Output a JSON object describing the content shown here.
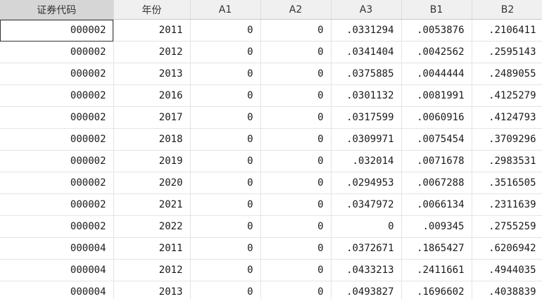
{
  "columns": [
    "证券代码",
    "年份",
    "A1",
    "A2",
    "A3",
    "B1",
    "B2"
  ],
  "rows": [
    [
      "000002",
      "2011",
      "0",
      "0",
      ".0331294",
      ".0053876",
      ".2106411"
    ],
    [
      "000002",
      "2012",
      "0",
      "0",
      ".0341404",
      ".0042562",
      ".2595143"
    ],
    [
      "000002",
      "2013",
      "0",
      "0",
      ".0375885",
      ".0044444",
      ".2489055"
    ],
    [
      "000002",
      "2016",
      "0",
      "0",
      ".0301132",
      ".0081991",
      ".4125279"
    ],
    [
      "000002",
      "2017",
      "0",
      "0",
      ".0317599",
      ".0060916",
      ".4124793"
    ],
    [
      "000002",
      "2018",
      "0",
      "0",
      ".0309971",
      ".0075454",
      ".3709296"
    ],
    [
      "000002",
      "2019",
      "0",
      "0",
      ".032014",
      ".0071678",
      ".2983531"
    ],
    [
      "000002",
      "2020",
      "0",
      "0",
      ".0294953",
      ".0067288",
      ".3516505"
    ],
    [
      "000002",
      "2021",
      "0",
      "0",
      ".0347972",
      ".0066134",
      ".2311639"
    ],
    [
      "000002",
      "2022",
      "0",
      "0",
      "0",
      ".009345",
      ".2755259"
    ],
    [
      "000004",
      "2011",
      "0",
      "0",
      ".0372671",
      ".1865427",
      ".6206942"
    ],
    [
      "000004",
      "2012",
      "0",
      "0",
      ".0433213",
      ".2411661",
      ".4944035"
    ],
    [
      "000004",
      "2013",
      "0",
      "0",
      ".0493827",
      ".1696602",
      ".4038839"
    ]
  ]
}
